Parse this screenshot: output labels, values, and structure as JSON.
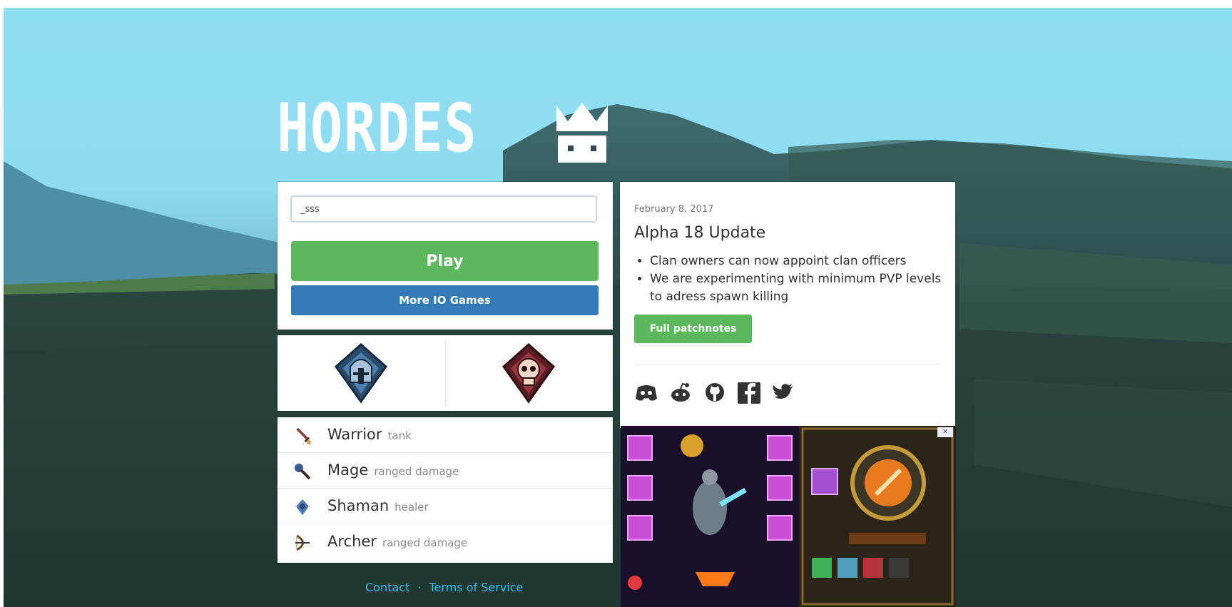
{
  "brand": {
    "logo_text": "HORDES",
    "logo_icon": "crown-icon"
  },
  "login": {
    "name_value": "_sss",
    "play_label": "Play",
    "more_games_label": "More IO Games"
  },
  "factions": [
    {
      "name": "vanguard",
      "icon": "helmet-shield-icon",
      "color": "#3a5e86"
    },
    {
      "name": "bloodlust",
      "icon": "skull-shield-icon",
      "color": "#8a2f36"
    }
  ],
  "classes": [
    {
      "name": "Warrior",
      "role": "tank",
      "icon": "sword-icon"
    },
    {
      "name": "Mage",
      "role": "ranged damage",
      "icon": "staff-icon"
    },
    {
      "name": "Shaman",
      "role": "healer",
      "icon": "totem-icon"
    },
    {
      "name": "Archer",
      "role": "ranged damage",
      "icon": "bow-icon"
    }
  ],
  "news": {
    "date": "February 8, 2017",
    "title": "Alpha 18 Update",
    "items": [
      "Clan owners can now appoint clan officers",
      "We are experimenting with minimum PVP levels to adress spawn killing"
    ],
    "patchnotes_label": "Full patchnotes"
  },
  "social": [
    "discord-icon",
    "reddit-icon",
    "github-icon",
    "facebook-icon",
    "twitter-icon"
  ],
  "footer": {
    "contact_label": "Contact",
    "separator": "·",
    "tos_label": "Terms of Service"
  },
  "colors": {
    "sky": "#8fdff3",
    "play_green": "#5cb85c",
    "more_blue": "#337ab7",
    "link": "#35c0ee"
  }
}
